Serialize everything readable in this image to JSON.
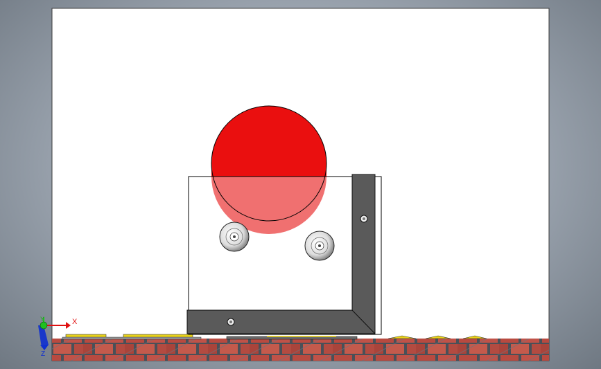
{
  "scene": {
    "background_color": "#9ea7b2",
    "graphics_area_color": "#ffffff",
    "part_edge_color": "#000000",
    "bracket_color": "#5a5a5a",
    "ball_color": "#ea0f0f",
    "ball_behind_glass_color": "#f07070",
    "floor_texture": "brick-floor",
    "floor_brick_color": "#b84a40",
    "floor_mortar_color": "#4a5058",
    "yellow_part_color": "#e8d21a"
  },
  "triad": {
    "x_label": "X",
    "y_label": "Y",
    "z_label": "Z",
    "x_color": "#e01010",
    "y_color": "#20c020",
    "z_color": "#1030d0"
  }
}
